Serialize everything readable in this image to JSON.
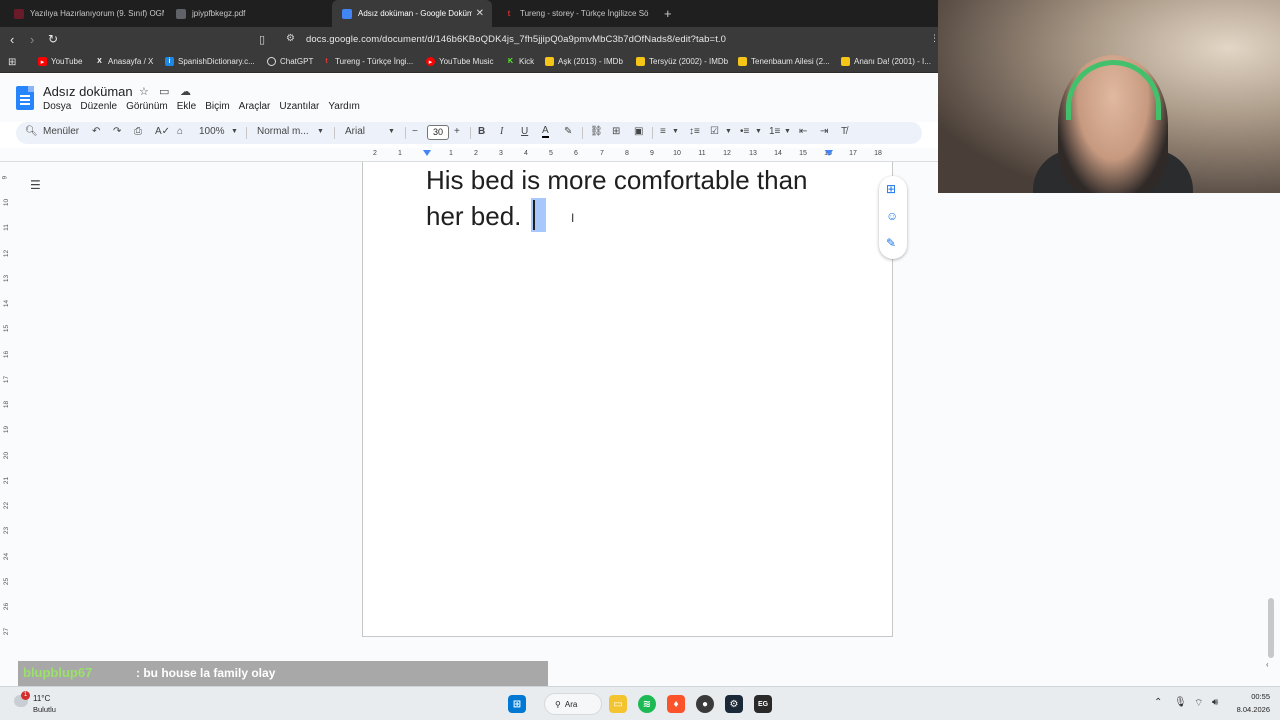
{
  "browser": {
    "tabs": [
      {
        "label": "Yazılıya Hazırlanıyorum (9. Sınıf) OGM"
      },
      {
        "label": "jpiypfbkegz.pdf"
      },
      {
        "label": "Adsız doküman - Google Doküm"
      },
      {
        "label": "Tureng - storey - Türkçe İngilizce Sö"
      }
    ],
    "url": "docs.google.com/document/d/146b6KBoQDK4js_7fh5jjipQ0a9pmvMbC3b7dOfNads8/edit?tab=t.0",
    "bookmarks": [
      {
        "label": "YouTube"
      },
      {
        "label": "Anasayfa / X"
      },
      {
        "label": "SpanishDictionary.c..."
      },
      {
        "label": "ChatGPT"
      },
      {
        "label": "Tureng - Türkçe İngi..."
      },
      {
        "label": "YouTube Music"
      },
      {
        "label": "Kick"
      },
      {
        "label": "Aşk (2013) - IMDb"
      },
      {
        "label": "Tersyüz (2002) - IMDb"
      },
      {
        "label": "Tenenbaum Ailesi (2..."
      },
      {
        "label": "Ananı Da! (2001) - I..."
      }
    ]
  },
  "docs": {
    "title": "Adsız doküman",
    "menu": [
      "Dosya",
      "Düzenle",
      "Görünüm",
      "Ekle",
      "Biçim",
      "Araçlar",
      "Uzantılar",
      "Yardım"
    ],
    "toolbar": {
      "search_menus": "Menüler",
      "zoom": "100%",
      "style": "Normal m...",
      "font": "Arial",
      "font_size": "30"
    },
    "ruler_numbers": [
      "2",
      "1",
      "1",
      "2",
      "3",
      "4",
      "5",
      "6",
      "7",
      "8",
      "9",
      "10",
      "11",
      "12",
      "13",
      "14",
      "15",
      "16",
      "17",
      "18"
    ],
    "vruler_numbers": [
      "9",
      "10",
      "11",
      "12",
      "13",
      "14",
      "15",
      "16",
      "17",
      "18",
      "19",
      "20",
      "21",
      "22",
      "23",
      "24",
      "25",
      "26",
      "27"
    ],
    "body_line1": "His bed is more comfortable than",
    "body_line2": "her bed."
  },
  "chat": {
    "user": "blupblup67",
    "message": ": bu house la family olay"
  },
  "taskbar": {
    "temperature": "11°C",
    "weather": "Bulutlu",
    "weather_badge": "1",
    "search_label": "Ara",
    "time": "00:55",
    "date": "8.04.2026"
  }
}
